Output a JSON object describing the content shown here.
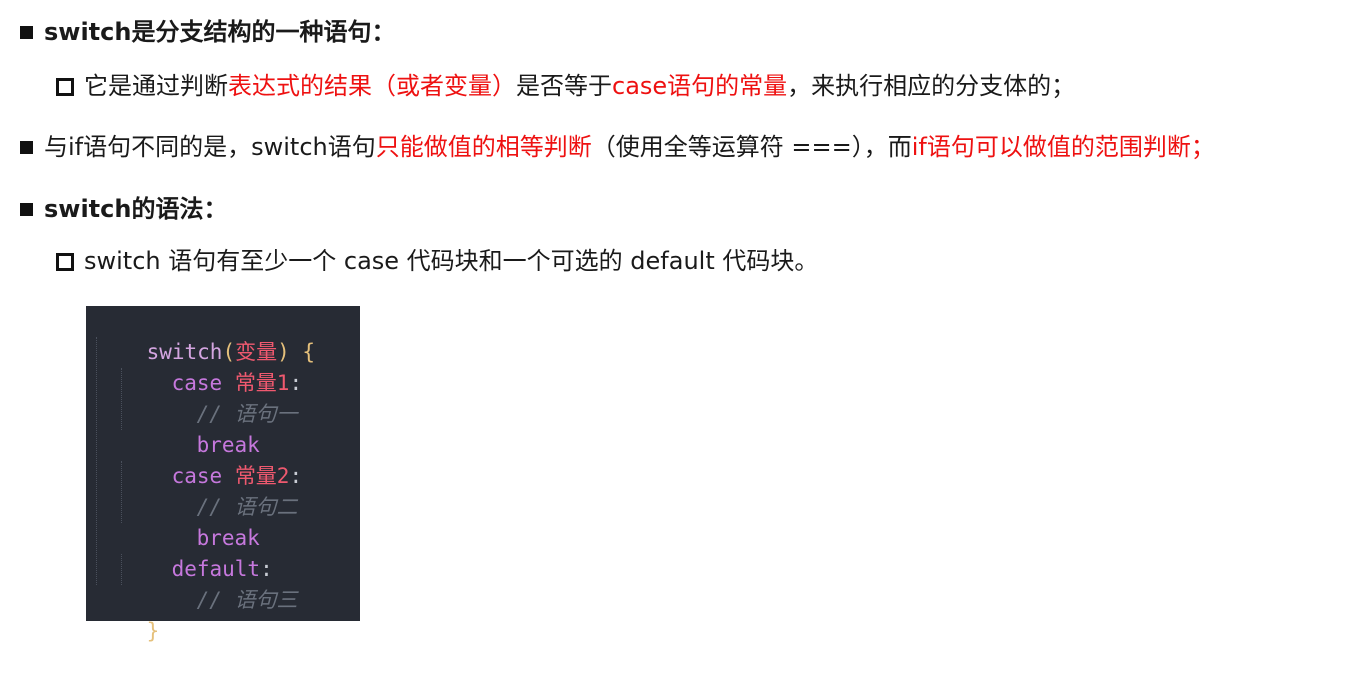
{
  "items": [
    {
      "level": 1,
      "segments": [
        {
          "text": "switch是分支结构的一种语句：",
          "style": "bold"
        }
      ]
    },
    {
      "level": 2,
      "segments": [
        {
          "text": "它是通过判断",
          "style": "normal"
        },
        {
          "text": "表达式的结果（或者变量）",
          "style": "red"
        },
        {
          "text": "是否等于",
          "style": "normal"
        },
        {
          "text": "case语句的常量",
          "style": "red"
        },
        {
          "text": "，来执行相应的分支体的；",
          "style": "normal"
        }
      ]
    },
    {
      "level": 1,
      "segments": [
        {
          "text": "与if语句不同的是，switch语句",
          "style": "normal"
        },
        {
          "text": "只能做值的相等判断",
          "style": "red"
        },
        {
          "text": "（使用全等运算符 ===），而",
          "style": "normal"
        },
        {
          "text": "if语句可以做值的范围判断；",
          "style": "red"
        }
      ]
    },
    {
      "level": 1,
      "segments": [
        {
          "text": "switch的语法：",
          "style": "bold"
        }
      ]
    },
    {
      "level": 2,
      "segments": [
        {
          "text": "switch 语句有至少一个 case 代码块和一个可选的 default 代码块。",
          "style": "normal"
        }
      ]
    }
  ],
  "code": {
    "lines": [
      {
        "tokens": [
          {
            "t": "switch",
            "c": "fn"
          },
          {
            "t": "(",
            "c": "paren"
          },
          {
            "t": "变量",
            "c": "var"
          },
          {
            "t": ")",
            "c": "paren"
          },
          {
            "t": " ",
            "c": "punc"
          },
          {
            "t": "{",
            "c": "paren"
          }
        ]
      },
      {
        "indent": 1,
        "tokens": [
          {
            "t": "case",
            "c": "kw"
          },
          {
            "t": " ",
            "c": "punc"
          },
          {
            "t": "常量1",
            "c": "var"
          },
          {
            "t": ":",
            "c": "punc"
          }
        ]
      },
      {
        "indent": 2,
        "tokens": [
          {
            "t": "// 语句一",
            "c": "cmt"
          }
        ]
      },
      {
        "indent": 2,
        "tokens": [
          {
            "t": "break",
            "c": "kw"
          }
        ]
      },
      {
        "indent": 1,
        "tokens": [
          {
            "t": "case",
            "c": "kw"
          },
          {
            "t": " ",
            "c": "punc"
          },
          {
            "t": "常量2",
            "c": "var"
          },
          {
            "t": ":",
            "c": "punc"
          }
        ]
      },
      {
        "indent": 2,
        "tokens": [
          {
            "t": "// 语句二",
            "c": "cmt"
          }
        ]
      },
      {
        "indent": 2,
        "tokens": [
          {
            "t": "break",
            "c": "kw"
          }
        ]
      },
      {
        "indent": 1,
        "tokens": [
          {
            "t": "default",
            "c": "kw"
          },
          {
            "t": ":",
            "c": "punc"
          }
        ]
      },
      {
        "indent": 2,
        "tokens": [
          {
            "t": "// 语句三",
            "c": "cmt"
          }
        ]
      },
      {
        "tokens": [
          {
            "t": "}",
            "c": "paren"
          }
        ]
      }
    ]
  }
}
